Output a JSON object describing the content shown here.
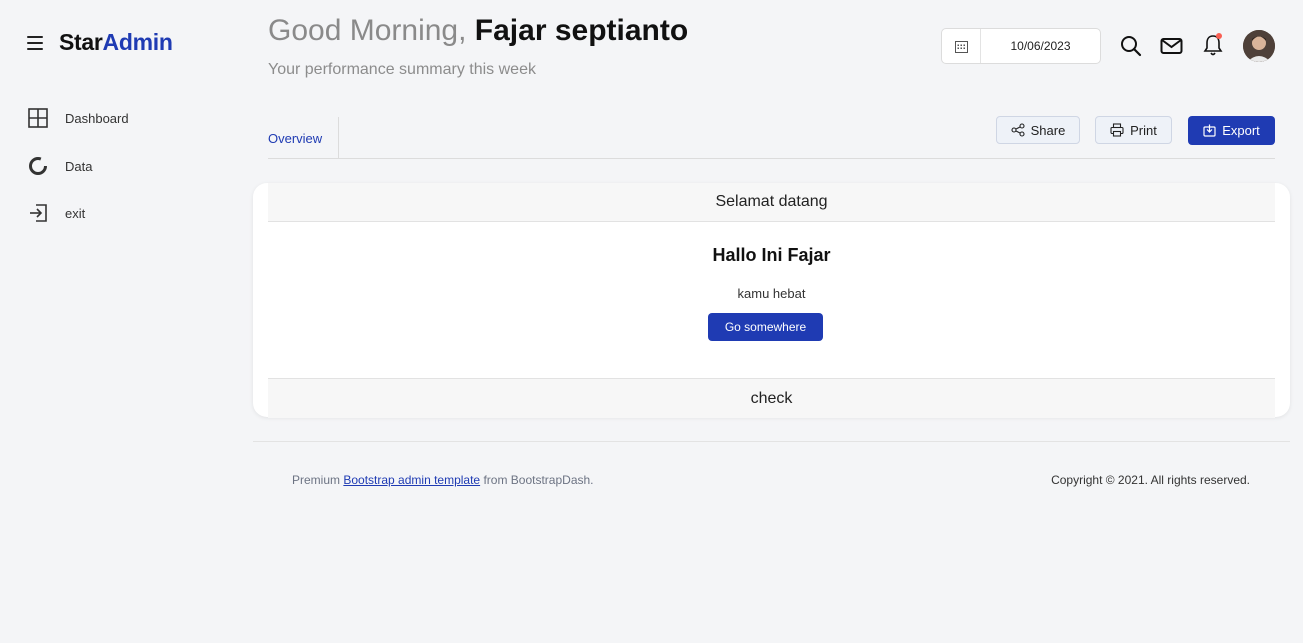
{
  "brand": {
    "part1": "Star",
    "part2": "Admin"
  },
  "sidebar": {
    "items": [
      {
        "label": "Dashboard",
        "icon": "grid-icon"
      },
      {
        "label": "Data",
        "icon": "donut-chart-icon"
      },
      {
        "label": "exit",
        "icon": "logout-icon"
      }
    ]
  },
  "header": {
    "greeting": "Good Morning,",
    "user_name": "Fajar septianto",
    "subtitle": "Your performance summary this week",
    "date": "10/06/2023"
  },
  "tabs": {
    "overview": "Overview"
  },
  "toolbar": {
    "share": "Share",
    "print": "Print",
    "export": "Export"
  },
  "card": {
    "header": "Selamat datang",
    "title": "Hallo Ini Fajar",
    "text": "kamu hebat",
    "button": "Go somewhere",
    "footer": "check"
  },
  "footer": {
    "prefix": "Premium",
    "link": "Bootstrap admin template",
    "suffix": "from BootstrapDash.",
    "copyright": "Copyright © 2021. All rights reserved."
  },
  "colors": {
    "accent": "#1f3bb3",
    "notification": "#f95f53"
  }
}
